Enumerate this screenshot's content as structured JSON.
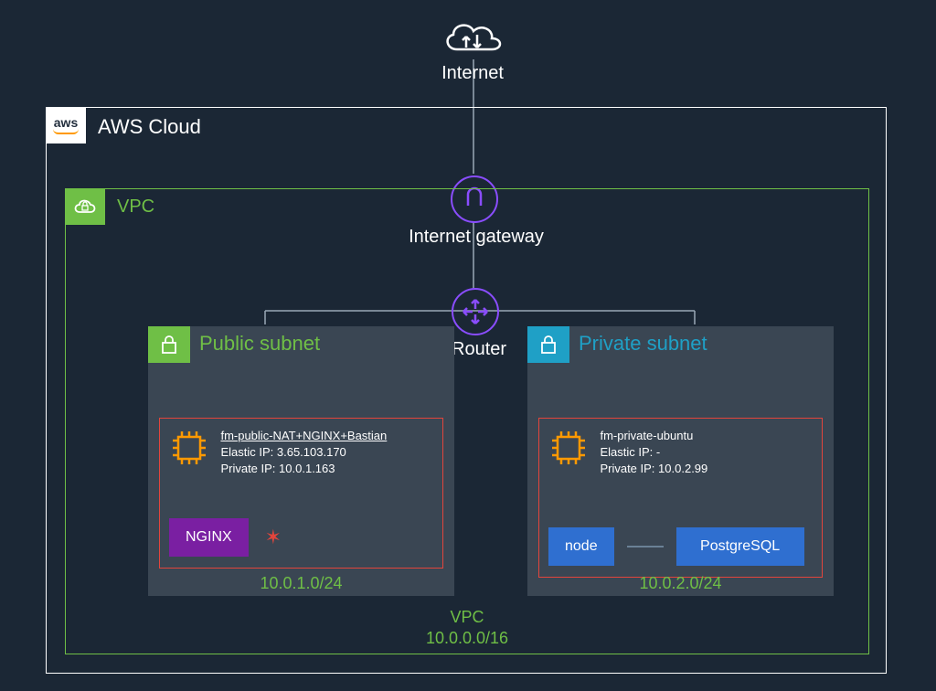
{
  "internet": {
    "label": "Internet"
  },
  "aws": {
    "title": "AWS Cloud",
    "logo_text": "aws"
  },
  "gateway": {
    "label": "Internet gateway"
  },
  "router": {
    "label": "Router"
  },
  "vpc": {
    "title": "VPC",
    "footer_name": "VPC",
    "cidr": "10.0.0.0/16"
  },
  "subnets": {
    "public": {
      "title": "Public subnet",
      "cidr": "10.0.1.0/24",
      "instance": {
        "name": "fm-public-NAT+NGINX+Bastian",
        "elastic_ip_label": "Elastic IP:",
        "elastic_ip": "3.65.103.170",
        "private_ip_label": "Private IP:",
        "private_ip": "10.0.1.163",
        "services": [
          "NGINX"
        ]
      }
    },
    "private": {
      "title": "Private subnet",
      "cidr": "10.0.2.0/24",
      "instance": {
        "name": "fm-private-ubuntu",
        "elastic_ip_label": "Elastic IP:",
        "elastic_ip": "-",
        "private_ip_label": "Private IP:",
        "private_ip": "10.0.2.99",
        "services": [
          "node",
          "PostgreSQL"
        ]
      }
    }
  },
  "colors": {
    "bg": "#1b2735",
    "vpc_green": "#6fbf46",
    "private_teal": "#1fa0c6",
    "instance_red": "#e2453c",
    "purple": "#8a4dff",
    "service_purple": "#7a1fa2",
    "service_blue": "#2f6fd0",
    "chip_orange": "#ff9900"
  }
}
